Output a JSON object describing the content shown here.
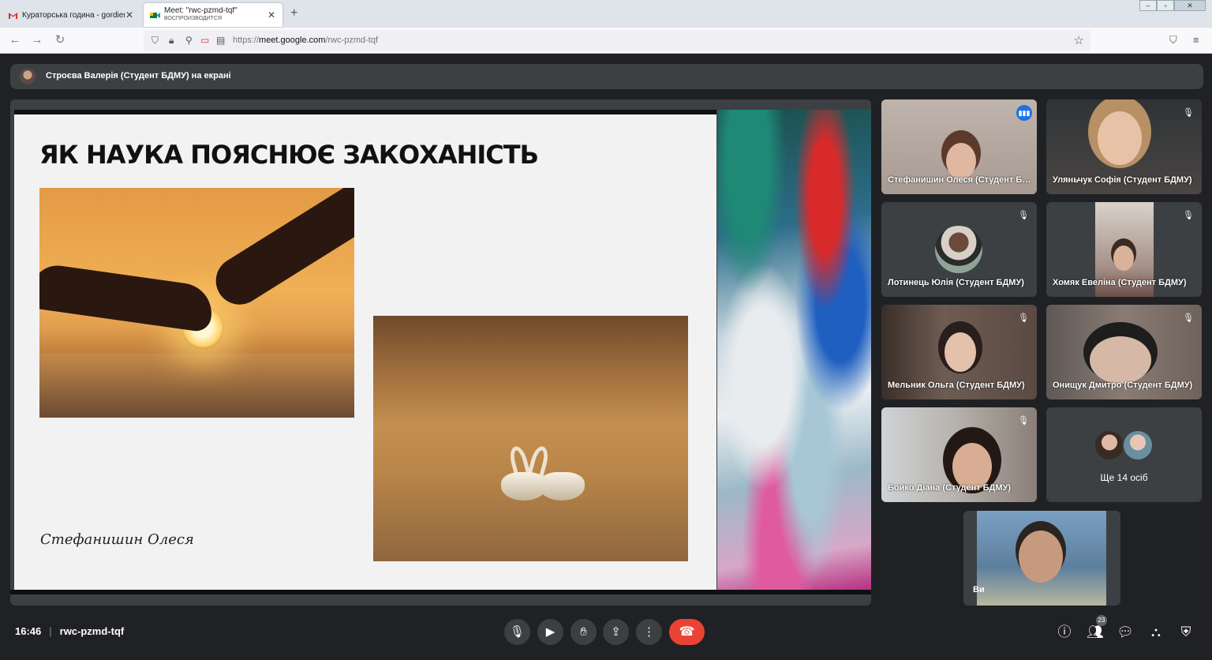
{
  "browser": {
    "tabs": [
      {
        "title": "Кураторська година - gordienk"
      },
      {
        "title": "Meet: \"rwc-pzmd-tqf\"",
        "subtitle": "ВОСПРОИЗВОДИТСЯ"
      }
    ],
    "url_prefix": "https://",
    "url_domain": "meet.google.com",
    "url_path": "/rwc-pzmd-tqf"
  },
  "meet": {
    "presenting_text": "Строєва Валерія (Студент БДМУ) на екрані",
    "slide": {
      "title": "ЯК НАУКА ПОЯСНЮЄ ЗАКОХАНІСТЬ",
      "author": "Стефанишин Олеся"
    },
    "participants": [
      {
        "name": "Стефанишин Олеся (Студент БДМУ)",
        "speaking": true
      },
      {
        "name": "Уляньчук Софія (Студент БДМУ)",
        "muted": true
      },
      {
        "name": "Лотинець Юлія (Студент БДМУ)",
        "muted": true
      },
      {
        "name": "Хомяк Евеліна (Студент БДМУ)",
        "muted": true
      },
      {
        "name": "Мельник Ольга (Студент БДМУ)",
        "muted": true
      },
      {
        "name": "Онищук Дмитро (Студент БДМУ)",
        "muted": true
      },
      {
        "name": "Бойко Діана (Студент БДМУ)",
        "muted": true
      }
    ],
    "more_label": "Ще 14 осіб",
    "self_label": "Ви",
    "time": "16:46",
    "meeting_code": "rwc-pzmd-tqf",
    "participant_count": "23",
    "colors": {
      "accent": "#8ab4f8",
      "end_call": "#ea4335",
      "speaking": "#1a73e8"
    }
  }
}
